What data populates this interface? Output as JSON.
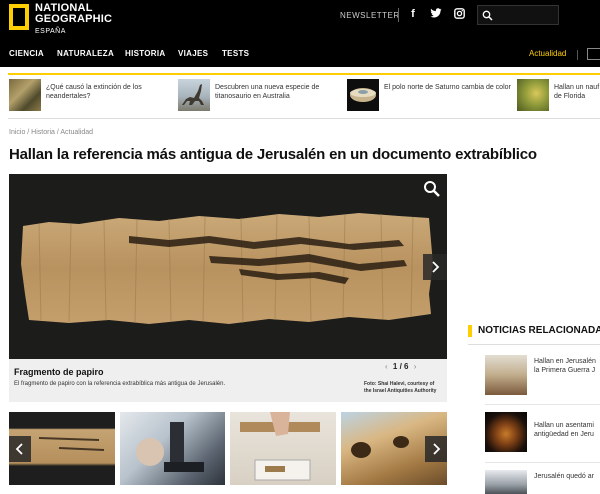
{
  "header": {
    "logo_line1": "NATIONAL",
    "logo_line2": "GEOGRAPHIC",
    "logo_sub": "ESPAÑA",
    "newsletter": "NEWSLETTER",
    "social": [
      "facebook-icon",
      "twitter-icon",
      "instagram-icon"
    ],
    "search_placeholder": ""
  },
  "nav": {
    "items": [
      "CIENCIA",
      "NATURALEZA",
      "HISTORIA",
      "VIAJES",
      "TESTS"
    ],
    "right_label": "Actualidad"
  },
  "strip": [
    {
      "text_1": "¿Qué causó la extinción de los",
      "text_2": "neandertales?"
    },
    {
      "text_1": "Descubren una nueva especie de",
      "text_2": "titanosaurio en Australia"
    },
    {
      "text_1": "El polo norte de Saturno cambia de color",
      "text_2": ""
    },
    {
      "text_1": "Hallan un nauf",
      "text_2": "de Florida"
    }
  ],
  "breadcrumb": "Inicio / Historia / Actualidad",
  "headline": "Hallan la referencia más antigua de Jerusalén en un documento extrabíblico",
  "gallery": {
    "caption_title": "Fragmento de papiro",
    "caption_desc": "El fragmento de papiro con la referencia extrabíblica más antigua de Jerusalén.",
    "pager": "1 / 6",
    "credit_1": "Foto: Shai Halevi, courtesy of",
    "credit_2": "the Israel Antiquities Authority"
  },
  "sidebar": {
    "title": "NOTICIAS RELACIONADAS",
    "items": [
      {
        "line1": "Hallan en Jerusalén",
        "line2": "la Primera Guerra J"
      },
      {
        "line1": "Hallan un asentami",
        "line2": "antigüedad en Jeru"
      },
      {
        "line1": "Jerusalén quedó ar",
        "line2": ""
      }
    ]
  },
  "colors": {
    "accent": "#ffce00",
    "topbar": "#000000"
  }
}
